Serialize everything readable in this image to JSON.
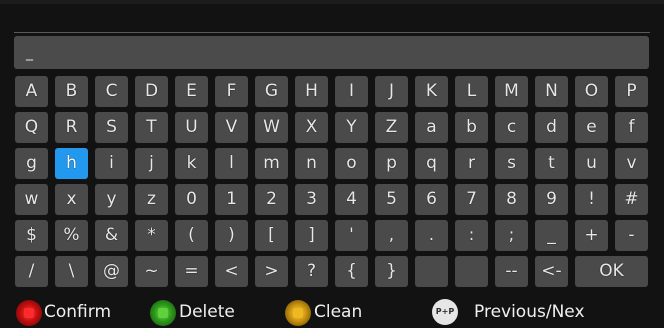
{
  "input": {
    "value": "_"
  },
  "keyboard": {
    "rows": [
      [
        "A",
        "B",
        "C",
        "D",
        "E",
        "F",
        "G",
        "H",
        "I",
        "J",
        "K",
        "L",
        "M",
        "N",
        "O",
        "P"
      ],
      [
        "Q",
        "R",
        "S",
        "T",
        "U",
        "V",
        "W",
        "X",
        "Y",
        "Z",
        "a",
        "b",
        "c",
        "d",
        "e",
        "f"
      ],
      [
        "g",
        "h",
        "i",
        "j",
        "k",
        "l",
        "m",
        "n",
        "o",
        "p",
        "q",
        "r",
        "s",
        "t",
        "u",
        "v"
      ],
      [
        "w",
        "x",
        "y",
        "z",
        "0",
        "1",
        "2",
        "3",
        "4",
        "5",
        "6",
        "7",
        "8",
        "9",
        "!",
        "#"
      ],
      [
        "$",
        "%",
        "&",
        "*",
        "(",
        ")",
        "[",
        "]",
        "'",
        ",",
        ".",
        ":",
        ";",
        "_",
        "+",
        "-"
      ],
      [
        "/",
        "\\",
        "@",
        "~",
        "=",
        "<",
        ">",
        "?",
        "{",
        "}",
        "",
        "",
        "--",
        "<-",
        "OK"
      ]
    ],
    "selected": "h",
    "selected_color": "#2299ee",
    "key_color": "#4a4a4a"
  },
  "legend": {
    "confirm": {
      "label": "Confirm",
      "icon": "red-button-icon",
      "color": "#cc1111"
    },
    "delete": {
      "label": "Delete",
      "icon": "green-button-icon",
      "color": "#33aa22"
    },
    "clean": {
      "label": "Clean",
      "icon": "yellow-button-icon",
      "color": "#d4a010"
    },
    "page": {
      "label": "Previous/Nex",
      "icon": "page-plus-minus-icon",
      "icon_text": "P+P"
    }
  }
}
